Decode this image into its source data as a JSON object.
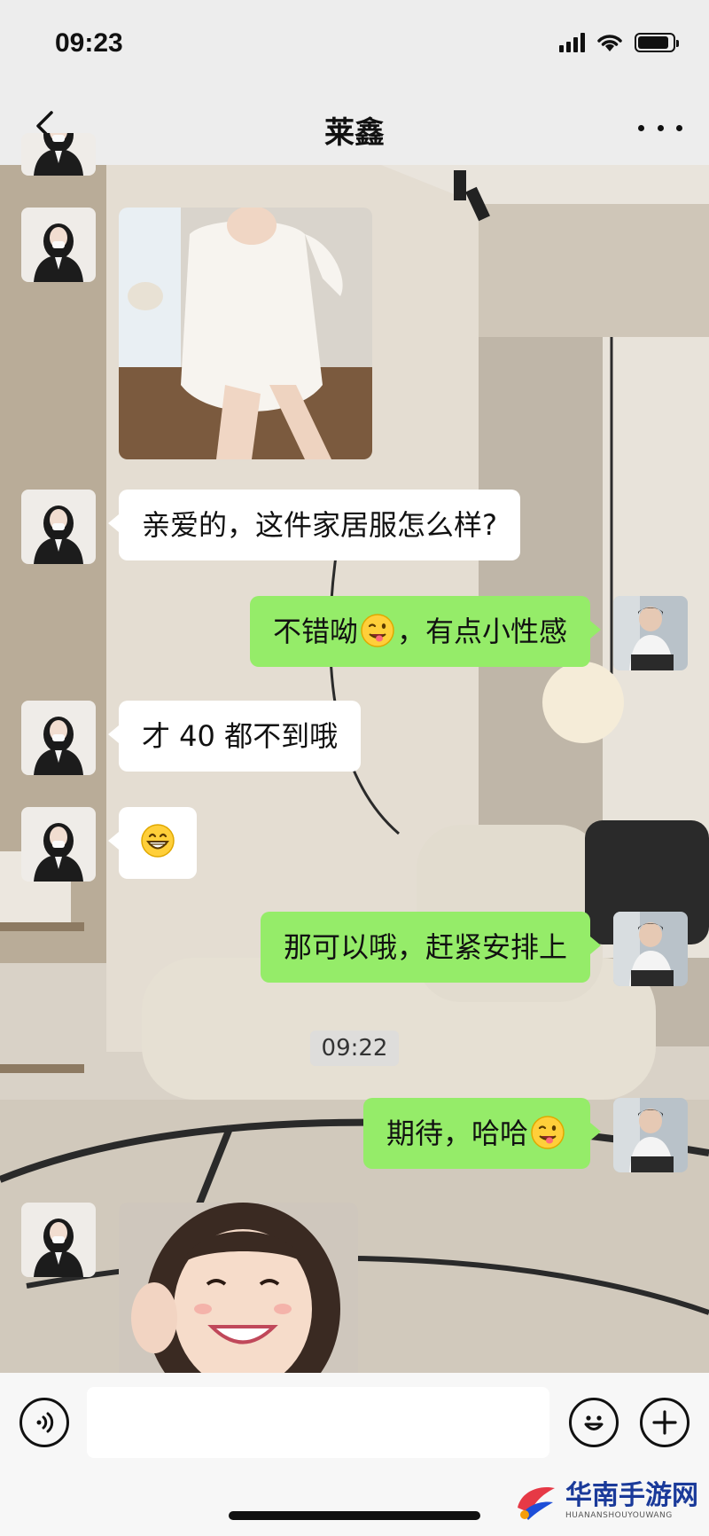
{
  "status_bar": {
    "time": "09:23",
    "battery_level": 0.9
  },
  "header": {
    "title": "莱鑫"
  },
  "icons": {
    "back": "chevron-left-icon",
    "more": "more-horizontal-icon",
    "voice": "voice-icon",
    "emoji": "smiley-icon",
    "plus": "plus-icon"
  },
  "colors": {
    "incoming_bubble": "#ffffff",
    "outgoing_bubble": "#95ec69",
    "header_bg": "#ededed"
  },
  "messages": [
    {
      "sender": "contact",
      "type": "image",
      "description": "photo"
    },
    {
      "sender": "contact",
      "type": "text",
      "text": "亲爱的，这件家居服怎么样?"
    },
    {
      "sender": "me",
      "type": "text",
      "text_before": "不错呦",
      "emoji": "winking-tongue-emoji",
      "text_after": "，有点小性感"
    },
    {
      "sender": "contact",
      "type": "text",
      "text": "才 40 都不到哦"
    },
    {
      "sender": "contact",
      "type": "emoji",
      "emoji": "grinning-emoji"
    },
    {
      "sender": "me",
      "type": "text",
      "text": "那可以哦，赶紧安排上"
    },
    {
      "sender": "me",
      "type": "text",
      "text_before": "期待，哈哈",
      "emoji": "winking-tongue-emoji",
      "text_after": ""
    },
    {
      "sender": "contact",
      "type": "image",
      "description": "photo"
    }
  ],
  "timestamp": "09:22",
  "watermark": {
    "main": "华南手游网",
    "sub": "HUANANSHOUYOUWANG"
  }
}
